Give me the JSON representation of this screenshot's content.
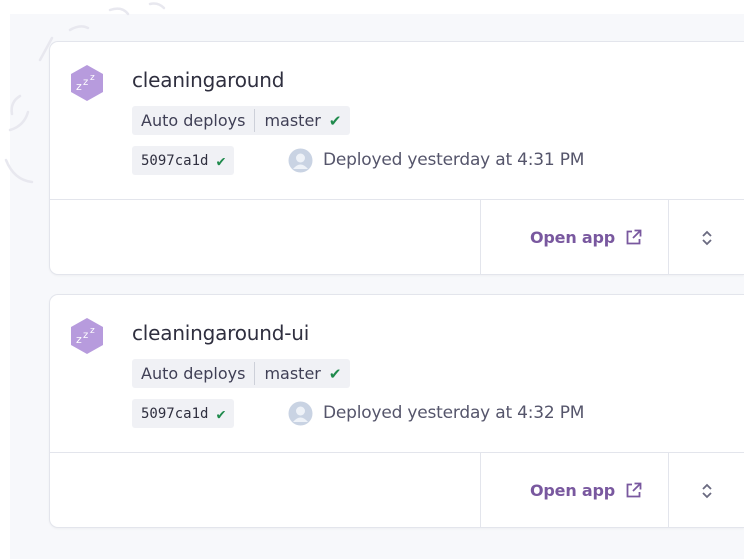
{
  "apps": [
    {
      "name": "cleaningaround",
      "auto_deploy_label": "Auto deploys",
      "branch": "master",
      "commit": "5097ca1d",
      "deployed_text": "Deployed yesterday at 4:31 PM",
      "open_app_label": "Open app"
    },
    {
      "name": "cleaningaround-ui",
      "auto_deploy_label": "Auto deploys",
      "branch": "master",
      "commit": "5097ca1d",
      "deployed_text": "Deployed yesterday at 4:32 PM",
      "open_app_label": "Open app"
    }
  ],
  "icons": {
    "app": "sleeping-dyno-icon",
    "check": "check-icon",
    "avatar": "user-avatar",
    "external": "external-link-icon",
    "expand": "chevron-up-down-icon"
  },
  "colors": {
    "accent": "#79589f",
    "success": "#1f8a4c",
    "app_icon": "#b79bdd"
  }
}
